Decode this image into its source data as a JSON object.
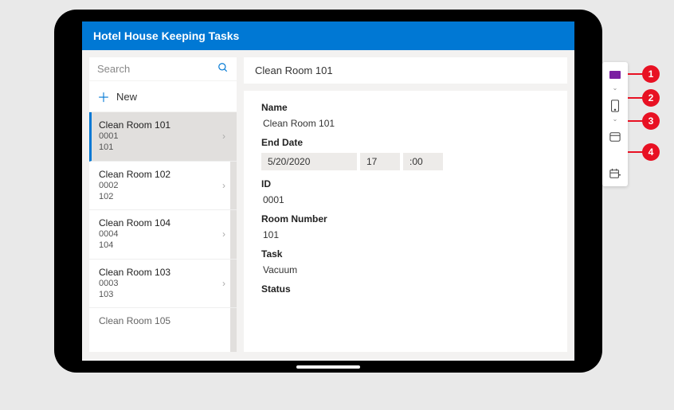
{
  "header": {
    "title": "Hotel House Keeping Tasks"
  },
  "search": {
    "placeholder": "Search"
  },
  "new_button": {
    "label": "New"
  },
  "tasks": [
    {
      "title": "Clean Room 101",
      "id": "0001",
      "room": "101",
      "selected": true
    },
    {
      "title": "Clean Room 102",
      "id": "0002",
      "room": "102",
      "selected": false
    },
    {
      "title": "Clean Room 104",
      "id": "0004",
      "room": "104",
      "selected": false
    },
    {
      "title": "Clean Room 103",
      "id": "0003",
      "room": "103",
      "selected": false
    },
    {
      "title": "Clean Room 105",
      "id": "",
      "room": "",
      "selected": false,
      "cutoff": true
    }
  ],
  "detail": {
    "header": "Clean Room 101",
    "labels": {
      "name": "Name",
      "end_date": "End Date",
      "id": "ID",
      "room_number": "Room Number",
      "task": "Task",
      "status": "Status"
    },
    "values": {
      "name": "Clean Room 101",
      "end_date": "5/20/2020",
      "end_hour": "17",
      "end_min": ":00",
      "id": "0001",
      "room_number": "101",
      "task": "Vacuum"
    }
  },
  "callouts": [
    "1",
    "2",
    "3",
    "4"
  ]
}
